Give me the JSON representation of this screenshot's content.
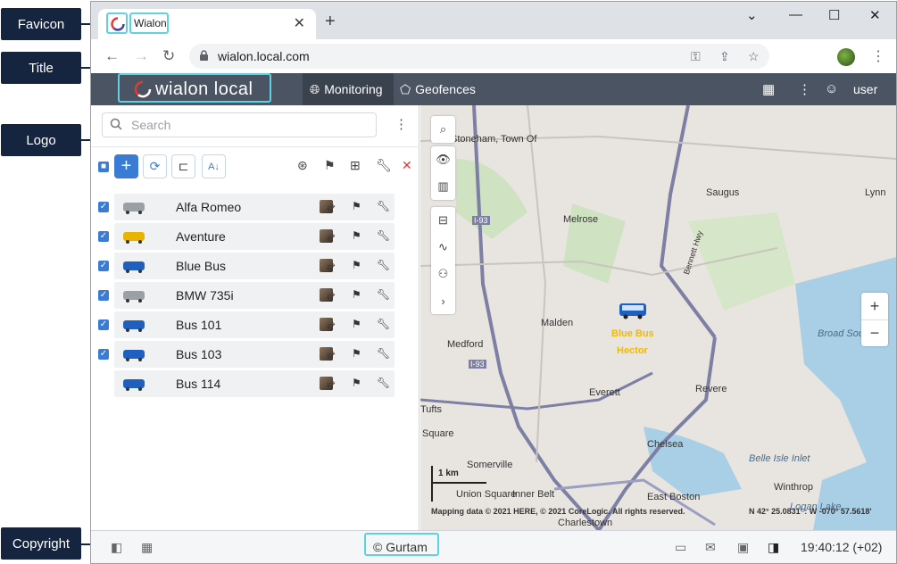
{
  "annotations": {
    "favicon": "Favicon",
    "title": "Title",
    "logo": "Logo",
    "copyright": "Copyright"
  },
  "browser": {
    "tab_title": "Wialon",
    "url": "wialon.local.com",
    "favicon_icon": "wialon-favicon",
    "avatar_icon": "profile-avatar"
  },
  "app": {
    "logo_text": "wialon local",
    "nav": {
      "monitoring": "Monitoring",
      "geofences": "Geofences"
    },
    "user": "user",
    "accent_color": "#3a7bd5",
    "header_color": "#4a5462"
  },
  "panel": {
    "search_placeholder": "Search",
    "units": [
      {
        "name": "Alfa Romeo",
        "checked": true,
        "icon": "car-icon"
      },
      {
        "name": "Aventure",
        "checked": true,
        "icon": "taxi-icon"
      },
      {
        "name": "Blue Bus",
        "checked": true,
        "icon": "bus-icon"
      },
      {
        "name": "BMW 735i",
        "checked": true,
        "icon": "car-top-icon"
      },
      {
        "name": "Bus 101",
        "checked": true,
        "icon": "bus-icon"
      },
      {
        "name": "Bus 103",
        "checked": true,
        "icon": "bus-icon"
      },
      {
        "name": "Bus 114",
        "checked": false,
        "icon": "bus-icon"
      }
    ]
  },
  "map": {
    "labels": [
      "Stoneham, Town Of",
      "Melrose",
      "Saugus",
      "Lynn",
      "Malden",
      "Medford",
      "Everett",
      "Revere",
      "Tufts",
      "Somerville",
      "Chelsea",
      "East Boston",
      "Charlestown",
      "Winthrop",
      "Broad Sound",
      "Belle Isle Inlet",
      "Inner Belt",
      "Union Square",
      "Square",
      "I-93",
      "I-93",
      "Bennett Hwy",
      "Logan Lake"
    ],
    "unit_marker": {
      "name": "Blue Bus",
      "driver": "Hector"
    },
    "scale": "1 km",
    "attribution": "Mapping data © 2021 HERE, © 2021 CoreLogic. All rights reserved.",
    "coordinates": "N 42° 25.0831' : W -070° 57.5618'"
  },
  "footer": {
    "copyright": "© Gurtam",
    "clock": "19:40:12 (+02)"
  }
}
